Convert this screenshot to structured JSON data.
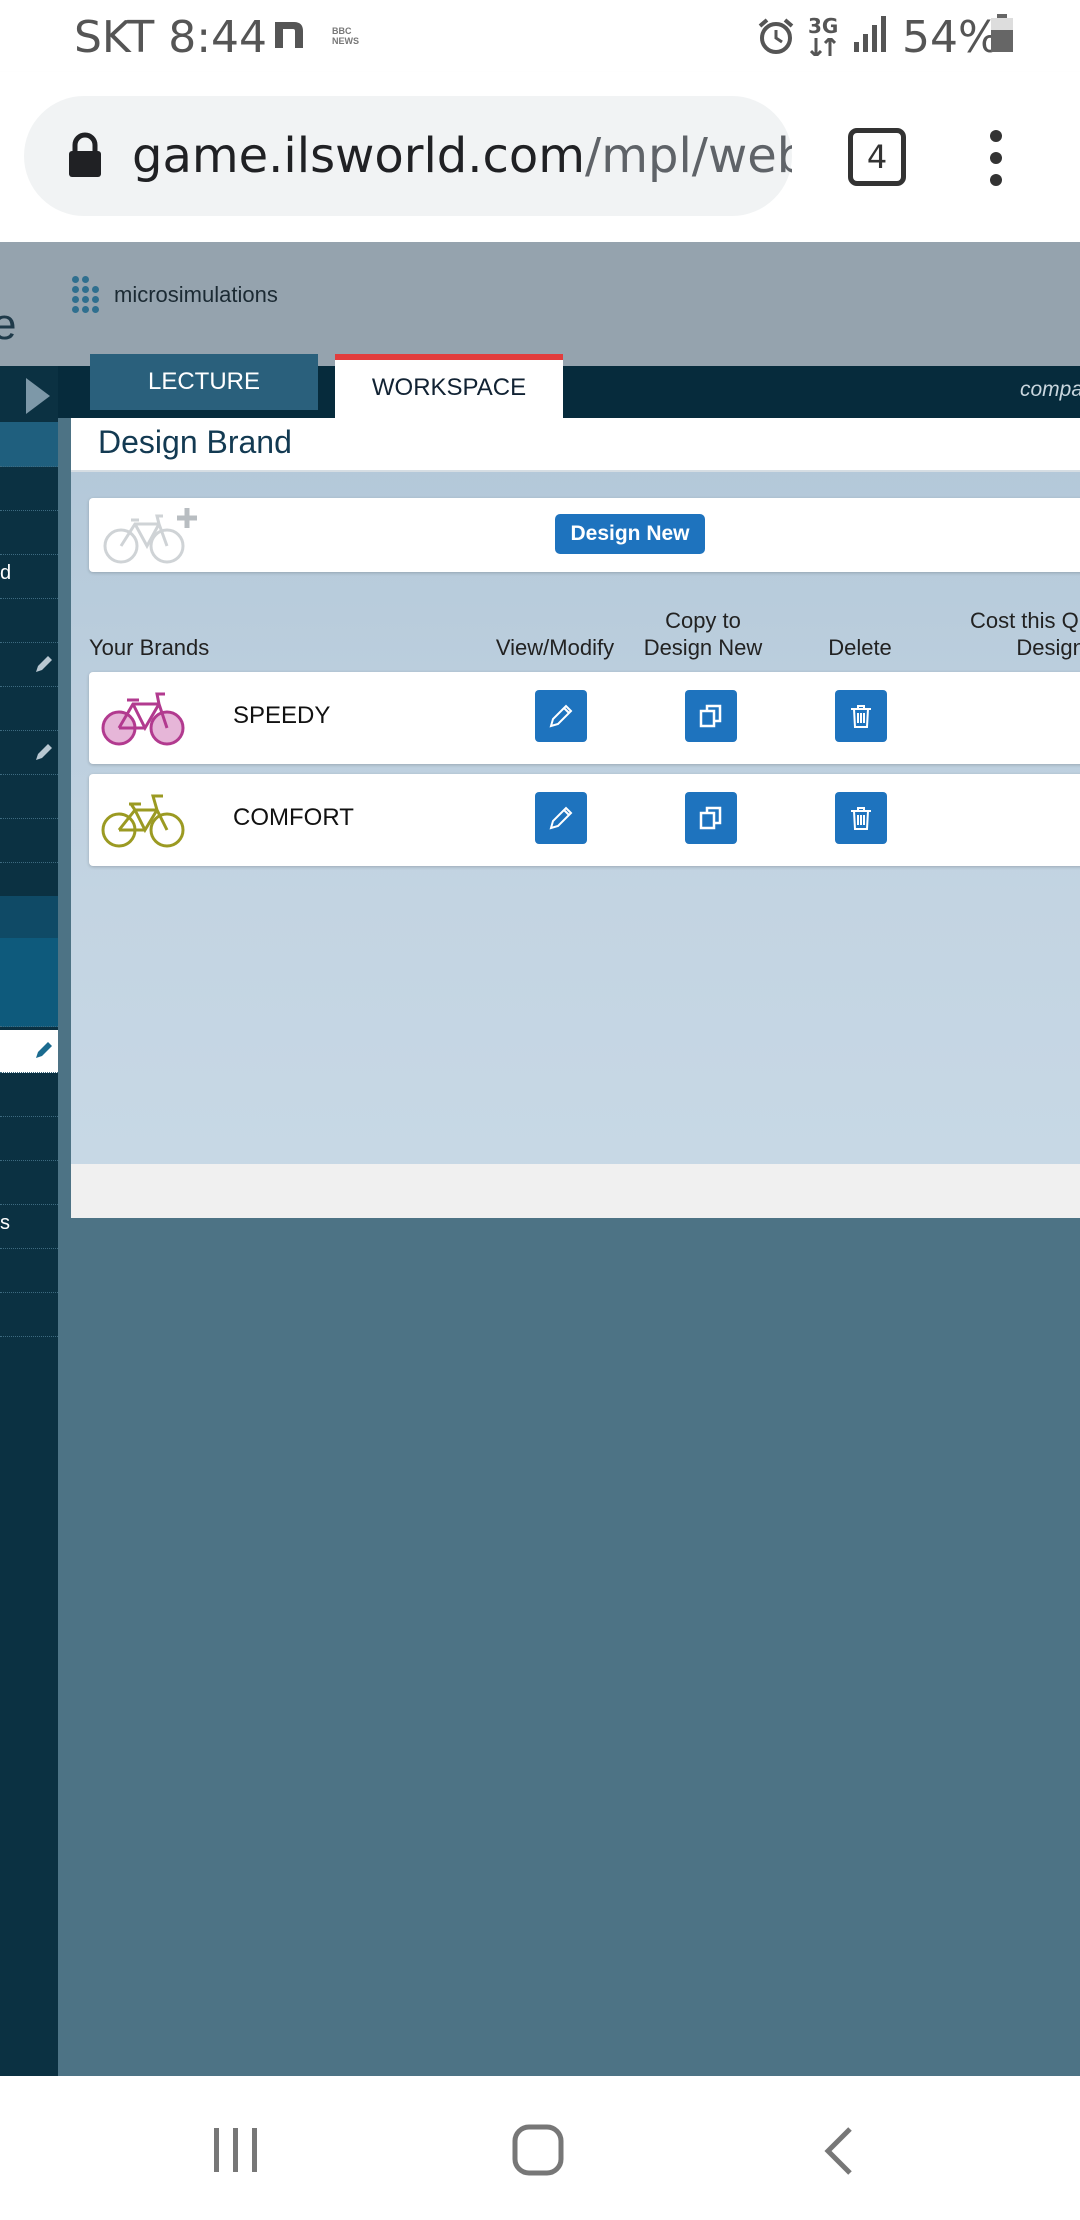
{
  "status_bar": {
    "carrier_time": "SKT 8:44",
    "news_label": "BBC NEWS",
    "network": "3G",
    "battery": "54%"
  },
  "browser": {
    "url_host": "game.ilsworld.com",
    "url_path": "/mpl/webb/",
    "tab_count": "4"
  },
  "app": {
    "header_title": "microsimulations",
    "cut_logo": "e",
    "company_fragment": "compa",
    "tabs": [
      {
        "label": "LECTURE"
      },
      {
        "label": "WORKSPACE"
      }
    ],
    "rail_fragments": [
      "d",
      "s"
    ]
  },
  "panel": {
    "title": "Design Brand",
    "design_new_label": "Design New",
    "columns": {
      "brands": "Your Brands",
      "view": "View/Modify",
      "copy": "Copy to Design New",
      "delete": "Delete",
      "cost": "Cost this Qu Design/"
    },
    "brands": [
      {
        "name": "SPEEDY",
        "color": "#b23a8f"
      },
      {
        "name": "COMFORT",
        "color": "#9b9a22"
      }
    ]
  },
  "colors": {
    "accent": "#1e73be",
    "active_tab_bar": "#e23c3c",
    "rail": "#0b3142"
  }
}
